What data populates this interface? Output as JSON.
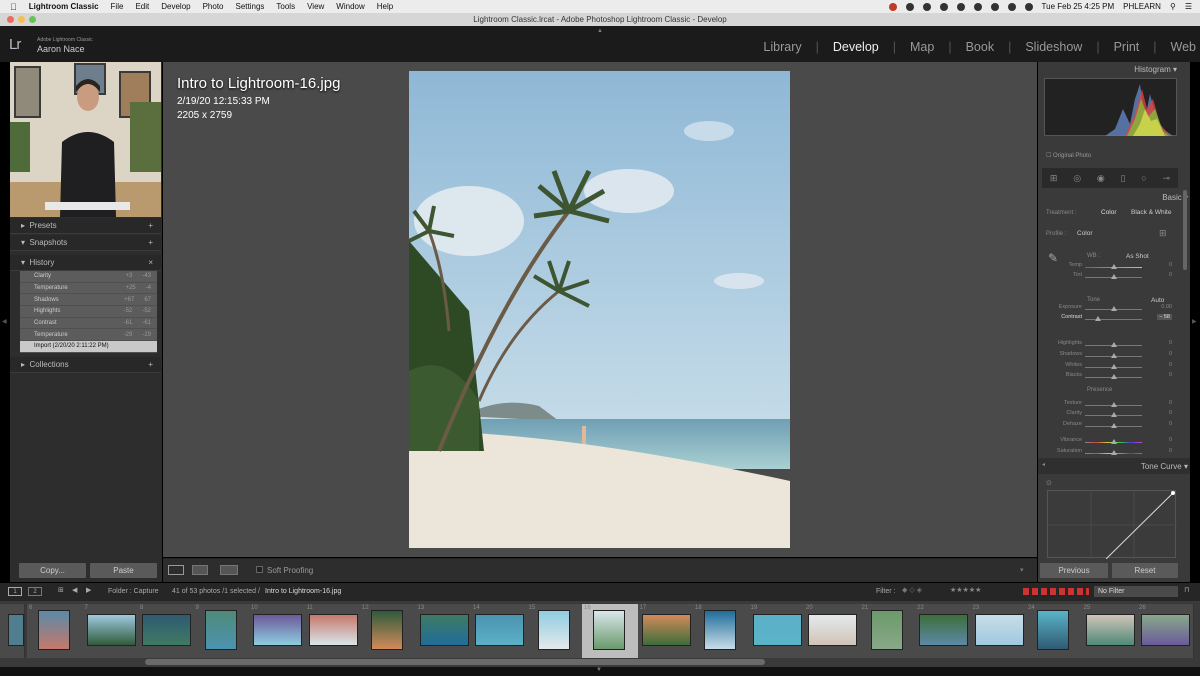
{
  "menubar": {
    "app": "Lightroom Classic",
    "items": [
      "File",
      "Edit",
      "Develop",
      "Photo",
      "Settings",
      "Tools",
      "View",
      "Window",
      "Help"
    ],
    "clock": "Tue Feb 25  4:25 PM",
    "user": "PHLEARN"
  },
  "window_title": "Lightroom Classic.lrcat - Adobe Photoshop Lightroom Classic - Develop",
  "identity": {
    "logo": "Lr",
    "product": "Adobe Lightroom Classic",
    "user": "Aaron Nace"
  },
  "modules": [
    "Library",
    "Develop",
    "Map",
    "Book",
    "Slideshow",
    "Print",
    "Web"
  ],
  "active_module": "Develop",
  "left_panel": {
    "presets": "Presets",
    "snapshots": "Snapshots",
    "history": "History",
    "collections": "Collections",
    "history_items": [
      {
        "label": "Clarity",
        "from": "+3",
        "to": "-43"
      },
      {
        "label": "Temperature",
        "from": "+25",
        "to": "-4"
      },
      {
        "label": "Shadows",
        "from": "+67",
        "to": "67"
      },
      {
        "label": "Highlights",
        "from": "-52",
        "to": "-52"
      },
      {
        "label": "Contrast",
        "from": "-61",
        "to": "-61"
      },
      {
        "label": "Temperature",
        "from": "-29",
        "to": "-29"
      },
      {
        "label": "Import (2/20/20 2:11:22 PM)",
        "from": "",
        "to": ""
      }
    ],
    "copy": "Copy...",
    "paste": "Paste"
  },
  "photo_info": {
    "filename": "Intro to Lightroom-16.jpg",
    "date": "2/19/20 12:15:33 PM",
    "dimensions": "2205 x 2759"
  },
  "toolbar": {
    "soft_proofing": "Soft Proofing"
  },
  "right_panel": {
    "histogram": "Histogram",
    "original_photo": "Original Photo",
    "basic": "Basic",
    "treatment": "Treatment :",
    "color": "Color",
    "bw": "Black & White",
    "profile": "Profile :",
    "profile_value": "Color",
    "wb": "WB :",
    "wb_value": "As Shot",
    "tone": "Tone",
    "auto": "Auto",
    "presence": "Presence",
    "tone_curve": "Tone Curve",
    "previous": "Previous",
    "reset": "Reset",
    "sliders": [
      {
        "label": "Temp",
        "value": "0",
        "pos": 0.5
      },
      {
        "label": "Tint",
        "value": "0",
        "pos": 0.5
      },
      {
        "label": "Exposure",
        "value": "0.00",
        "pos": 0.5
      },
      {
        "label": "Contrast",
        "value": "– 58",
        "pos": 0.22
      },
      {
        "label": "Highlights",
        "value": "0",
        "pos": 0.5
      },
      {
        "label": "Shadows",
        "value": "0",
        "pos": 0.5
      },
      {
        "label": "Whites",
        "value": "0",
        "pos": 0.5
      },
      {
        "label": "Blacks",
        "value": "0",
        "pos": 0.5
      },
      {
        "label": "Texture",
        "value": "0",
        "pos": 0.5
      },
      {
        "label": "Clarity",
        "value": "0",
        "pos": 0.5
      },
      {
        "label": "Dehaze",
        "value": "0",
        "pos": 0.5
      },
      {
        "label": "Vibrance",
        "value": "0",
        "pos": 0.5
      },
      {
        "label": "Saturation",
        "value": "0",
        "pos": 0.5
      }
    ]
  },
  "filmstrip": {
    "page1": "1",
    "page2": "2",
    "folder": "Folder : Capture",
    "count": "41 of 53 photos /1 selected /",
    "file": "Intro to Lightroom-16.jpg",
    "filter_label": "Filter :",
    "filter_value": "No Filter",
    "numbers": [
      "6",
      "7",
      "8",
      "9",
      "10",
      "11",
      "12",
      "13",
      "14",
      "15",
      "16",
      "17",
      "18",
      "19",
      "20",
      "21",
      "22",
      "23",
      "24",
      "25",
      "26"
    ]
  }
}
